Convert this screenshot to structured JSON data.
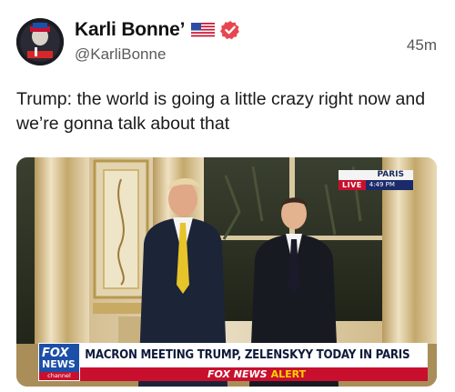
{
  "post": {
    "author": {
      "display_name": "Karli Bonne’",
      "handle": "@KarliBonne",
      "flag_icon": "us-flag-emoji",
      "verified_icon": "verified-badge-icon",
      "verified_color": "#e8464f"
    },
    "timestamp": "45m",
    "text": "Trump: the world is going a little crazy right now and we’re gonna talk about that"
  },
  "media": {
    "broadcast": {
      "live_city": "PARIS",
      "live_label": "LIVE",
      "live_time": "4:49 PM",
      "logo_line1": "FOX",
      "logo_line2": "NEWS",
      "logo_line3": "channel",
      "headline": "MACRON MEETING TRUMP, ZELENSKYY TODAY IN PARIS",
      "alert_brand": "FOX NEWS",
      "alert_label": "ALERT"
    }
  },
  "colors": {
    "fox_blue": "#1c4fa8",
    "fox_red": "#c8102e",
    "alert_yellow": "#ffd400"
  }
}
